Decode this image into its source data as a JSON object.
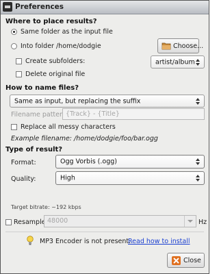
{
  "window": {
    "title": "Preferences"
  },
  "placement": {
    "heading": "Where to place results?",
    "same_folder_label": "Same folder as the input file",
    "into_folder_label": "Into folder /home/dodgie",
    "choose_label": "Choose...",
    "create_subfolders_label": "Create subfolders:",
    "subfolder_pattern": "artist/album",
    "delete_original_label": "Delete original file"
  },
  "naming": {
    "heading": "How to name files?",
    "scheme": "Same as input, but replacing the suffix",
    "pattern_label": "Filename pattern:",
    "pattern_value": "{Track} - {Title}",
    "replace_messy_label": "Replace all messy characters",
    "example_label": "Example filename:",
    "example_value": "/home/dodgie/foo/bar.ogg"
  },
  "result_type": {
    "heading": "Type of result?",
    "format_label": "Format:",
    "format_value": "Ogg Vorbis (.ogg)",
    "quality_label": "Quality:",
    "quality_value": "High",
    "bitrate_text": "Target bitrate: ~192 kbps"
  },
  "resample": {
    "label": "Resample",
    "value": "48000",
    "unit": "Hz"
  },
  "notice": {
    "text": "MP3 Encoder is not present.",
    "link": "Read how to install"
  },
  "buttons": {
    "close_label": "Close"
  }
}
